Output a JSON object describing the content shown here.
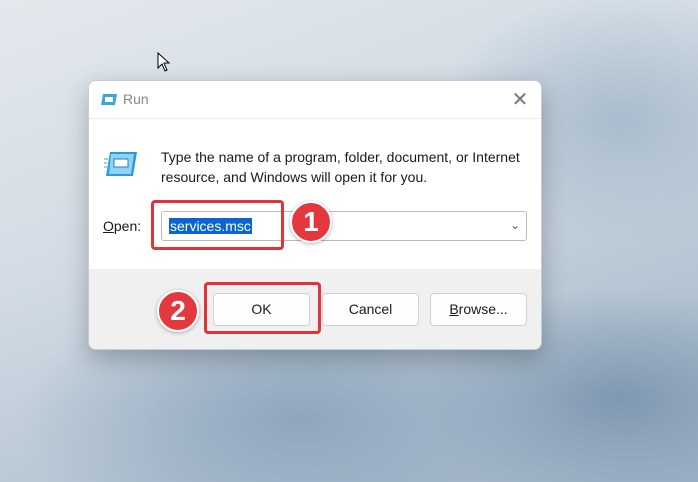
{
  "dialog": {
    "title": "Run",
    "description": "Type the name of a program, folder, document, or Internet resource, and Windows will open it for you.",
    "open_label": "Open:",
    "input_value": "services.msc",
    "buttons": {
      "ok": "OK",
      "cancel": "Cancel",
      "browse": "Browse..."
    }
  },
  "annotations": {
    "step1": "1",
    "step2": "2"
  },
  "colors": {
    "accent": "#0a64d2",
    "annotation": "#e3393e"
  }
}
